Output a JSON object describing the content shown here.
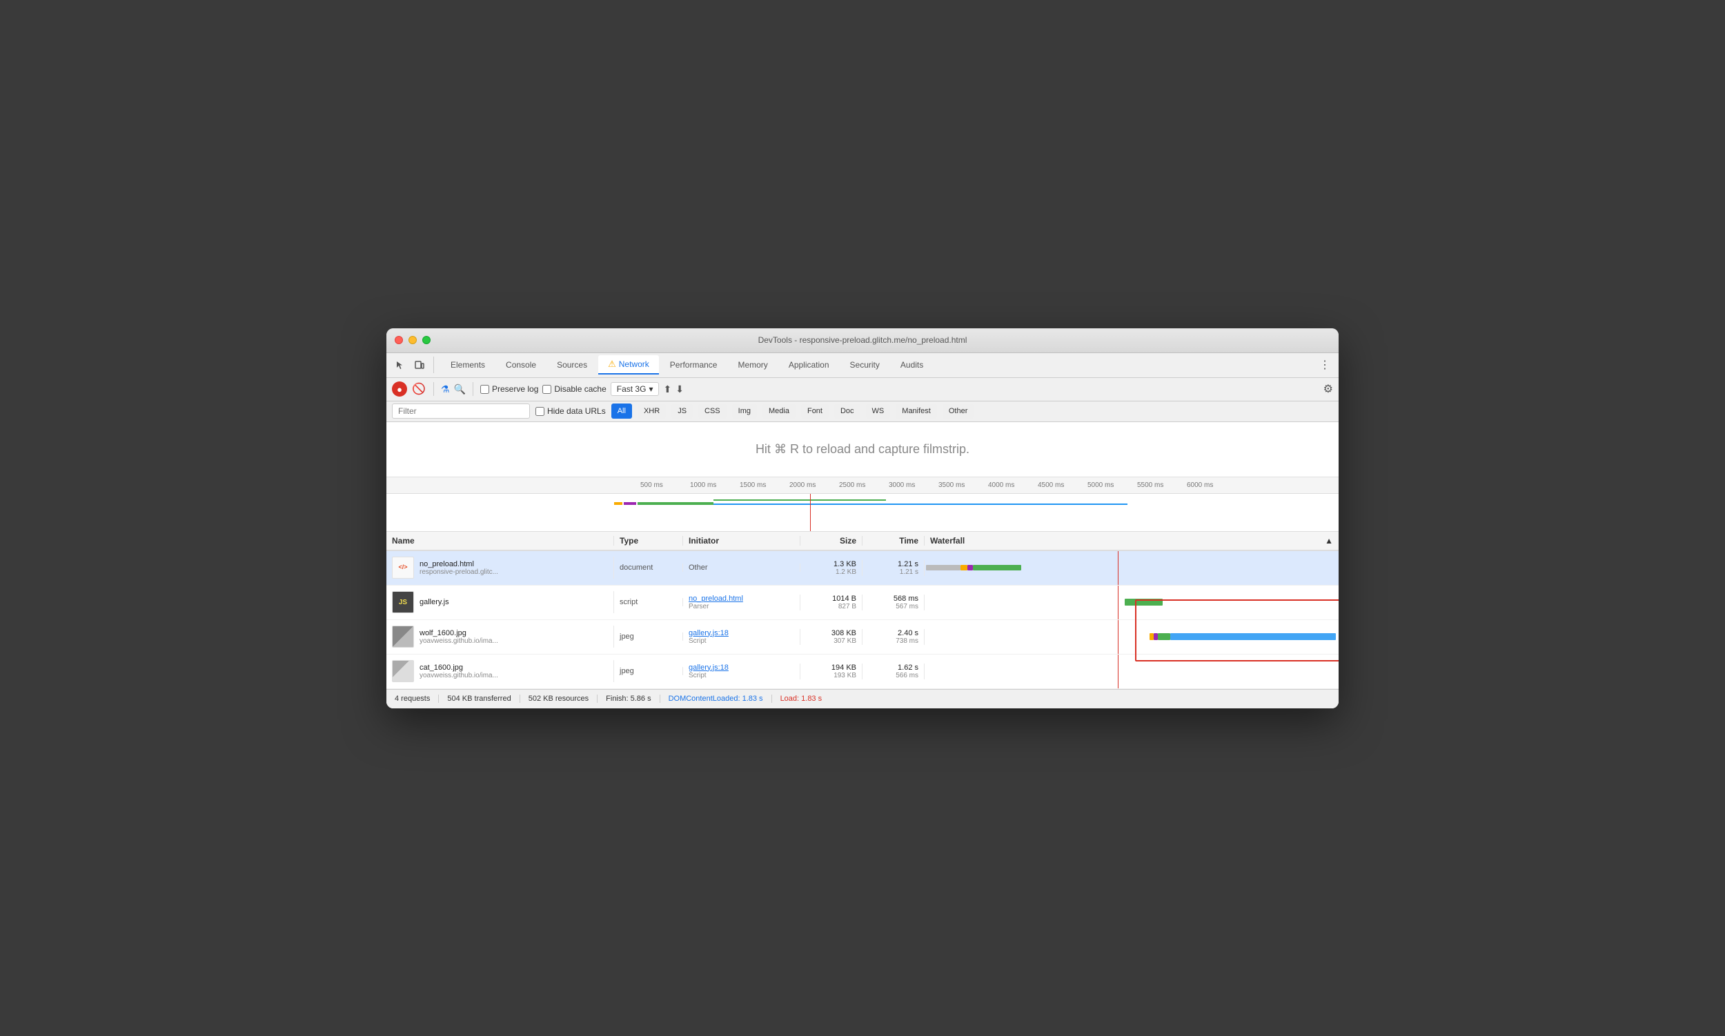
{
  "window": {
    "title": "DevTools - responsive-preload.glitch.me/no_preload.html"
  },
  "tabs": [
    {
      "id": "elements",
      "label": "Elements",
      "active": false
    },
    {
      "id": "console",
      "label": "Console",
      "active": false
    },
    {
      "id": "sources",
      "label": "Sources",
      "active": false
    },
    {
      "id": "network",
      "label": "Network",
      "active": true,
      "warning": true
    },
    {
      "id": "performance",
      "label": "Performance",
      "active": false
    },
    {
      "id": "memory",
      "label": "Memory",
      "active": false
    },
    {
      "id": "application",
      "label": "Application",
      "active": false
    },
    {
      "id": "security",
      "label": "Security",
      "active": false
    },
    {
      "id": "audits",
      "label": "Audits",
      "active": false
    }
  ],
  "toolbar": {
    "preserve_log_label": "Preserve log",
    "disable_cache_label": "Disable cache",
    "throttle_label": "Fast 3G"
  },
  "filter": {
    "placeholder": "Filter",
    "hide_data_urls": "Hide data URLs",
    "buttons": [
      "All",
      "XHR",
      "JS",
      "CSS",
      "Img",
      "Media",
      "Font",
      "Doc",
      "WS",
      "Manifest",
      "Other"
    ]
  },
  "filmstrip": {
    "message": "Hit ⌘ R to reload and capture filmstrip."
  },
  "timeline": {
    "ticks": [
      "500 ms",
      "1000 ms",
      "1500 ms",
      "2000 ms",
      "2500 ms",
      "3000 ms",
      "3500 ms",
      "4000 ms",
      "4500 ms",
      "5000 ms",
      "5500 ms",
      "6000 ms"
    ]
  },
  "table_headers": {
    "name": "Name",
    "type": "Type",
    "initiator": "Initiator",
    "size": "Size",
    "time": "Time",
    "waterfall": "Waterfall"
  },
  "rows": [
    {
      "id": "row1",
      "name": "no_preload.html",
      "url": "responsive-preload.glitc...",
      "type": "document",
      "initiator": "Other",
      "initiator_link": false,
      "size_top": "1.3 KB",
      "size_bot": "1.2 KB",
      "time_top": "1.21 s",
      "time_bot": "1.21 s",
      "selected": true
    },
    {
      "id": "row2",
      "name": "gallery.js",
      "url": "",
      "type": "script",
      "initiator": "no_preload.html",
      "initiator_sub": "Parser",
      "initiator_link": true,
      "size_top": "1014 B",
      "size_bot": "827 B",
      "time_top": "568 ms",
      "time_bot": "567 ms",
      "selected": false
    },
    {
      "id": "row3",
      "name": "wolf_1600.jpg",
      "url": "yoavweiss.github.io/ima...",
      "type": "jpeg",
      "initiator": "gallery.js:18",
      "initiator_sub": "Script",
      "initiator_link": true,
      "size_top": "308 KB",
      "size_bot": "307 KB",
      "time_top": "2.40 s",
      "time_bot": "738 ms",
      "selected": false
    },
    {
      "id": "row4",
      "name": "cat_1600.jpg",
      "url": "yoavweiss.github.io/ima...",
      "type": "jpeg",
      "initiator": "gallery.js:18",
      "initiator_sub": "Script",
      "initiator_link": true,
      "size_top": "194 KB",
      "size_bot": "193 KB",
      "time_top": "1.62 s",
      "time_bot": "566 ms",
      "selected": false
    }
  ],
  "status_bar": {
    "requests": "4 requests",
    "transferred": "504 KB transferred",
    "resources": "502 KB resources",
    "finish": "Finish: 5.86 s",
    "dom_content_loaded": "DOMContentLoaded: 1.83 s",
    "load": "Load: 1.83 s"
  }
}
